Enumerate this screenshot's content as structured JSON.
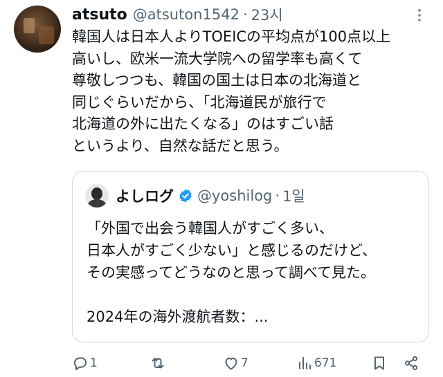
{
  "tweet": {
    "author_name": "atsuto",
    "author_handle": "@atsuton1542",
    "separator": "·",
    "time": "23시",
    "text_lines": [
      "韓国人は日本人よりTOEICの平均点が100点以上",
      "高いし、欧米一流大学院への留学率も高くて",
      "尊敬しつつも、韓国の国土は日本の北海道と",
      "同じぐらいだから、「北海道民が旅行で",
      "北海道の外に出たくなる」のはすごい話",
      "というより、自然な話だと思う。"
    ]
  },
  "quote": {
    "author_name": "よしログ",
    "author_handle": "@yoshilog",
    "separator": "·",
    "time": "1일",
    "text_lines": [
      "「外国で出会う韓国人がすごく多い、",
      "日本人がすごく少ない」と感じるのだけど、",
      "その実感ってどうなのと思って調べて見た。",
      "",
      "2024年の海外渡航者数：..."
    ]
  },
  "actions": {
    "reply_count": "1",
    "repost_count": "",
    "like_count": "7",
    "views_count": "671"
  },
  "icons": {
    "more": "more-dots-icon",
    "verified": "verified-badge-icon",
    "reply": "reply-icon",
    "repost": "repost-icon",
    "like": "heart-icon",
    "views": "views-icon",
    "bookmark": "bookmark-icon",
    "share": "share-icon"
  },
  "colors": {
    "text": "#0f1419",
    "secondary": "#536471",
    "verified": "#1d9bf0",
    "border": "#cfd9de"
  }
}
